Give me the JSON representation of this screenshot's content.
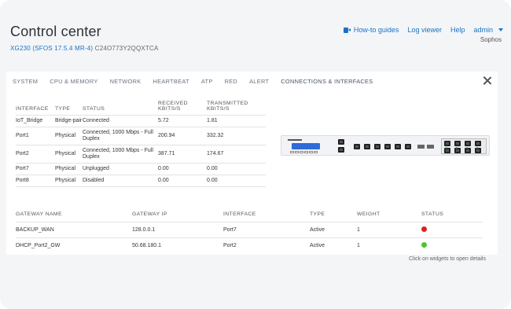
{
  "header": {
    "title": "Control center",
    "model": "XG230 (SFOS 17.5.4 MR-4)",
    "serial": "C24O773Y2QQXTCA",
    "brand": "Sophos"
  },
  "topnav": {
    "howto": "How-to guides",
    "logviewer": "Log viewer",
    "help": "Help",
    "admin": "admin"
  },
  "tabs": [
    "SYSTEM",
    "CPU & MEMORY",
    "NETWORK",
    "HEARTBEAT",
    "ATP",
    "RED",
    "ALERT",
    "CONNECTIONS & INTERFACES"
  ],
  "interfaces": {
    "headers": [
      "INTERFACE",
      "TYPE",
      "STATUS",
      "RECEIVED KBITS/S",
      "TRANSMITTED KBITS/S"
    ],
    "rows": [
      {
        "name": "IoT_Bridge",
        "type": "Bridge-pair",
        "status": "Connected",
        "rx": "5.72",
        "tx": "1.81"
      },
      {
        "name": "Port1",
        "type": "Physical",
        "status": "Connected, 1000 Mbps - Full Duplex",
        "rx": "200.94",
        "tx": "332.32"
      },
      {
        "name": "Port2",
        "type": "Physical",
        "status": "Connected, 1000 Mbps - Full Duplex",
        "rx": "387.71",
        "tx": "174.67"
      },
      {
        "name": "Port7",
        "type": "Physical",
        "status": "Unplugged",
        "rx": "0.00",
        "tx": "0.00"
      },
      {
        "name": "Port8",
        "type": "Physical",
        "status": "Disabled",
        "rx": "0.00",
        "tx": "0.00"
      }
    ]
  },
  "gateways": {
    "headers": [
      "GATEWAY NAME",
      "GATEWAY IP",
      "INTERFACE",
      "TYPE",
      "WEIGHT",
      "STATUS"
    ],
    "rows": [
      {
        "name": "BACKUP_WAN",
        "ip": "128.0.0.1",
        "interface": "Port7",
        "type": "Active",
        "weight": "1",
        "status_color": "#e02020"
      },
      {
        "name": "DHCP_Port2_GW",
        "ip": "50.68.180.1",
        "interface": "Port2",
        "type": "Active",
        "weight": "1",
        "status_color": "#4cc42a"
      }
    ]
  },
  "hint": "Click on widgets to open details",
  "colors": {
    "accent": "#1a73c6",
    "down": "#e02020",
    "up": "#4cc42a"
  }
}
